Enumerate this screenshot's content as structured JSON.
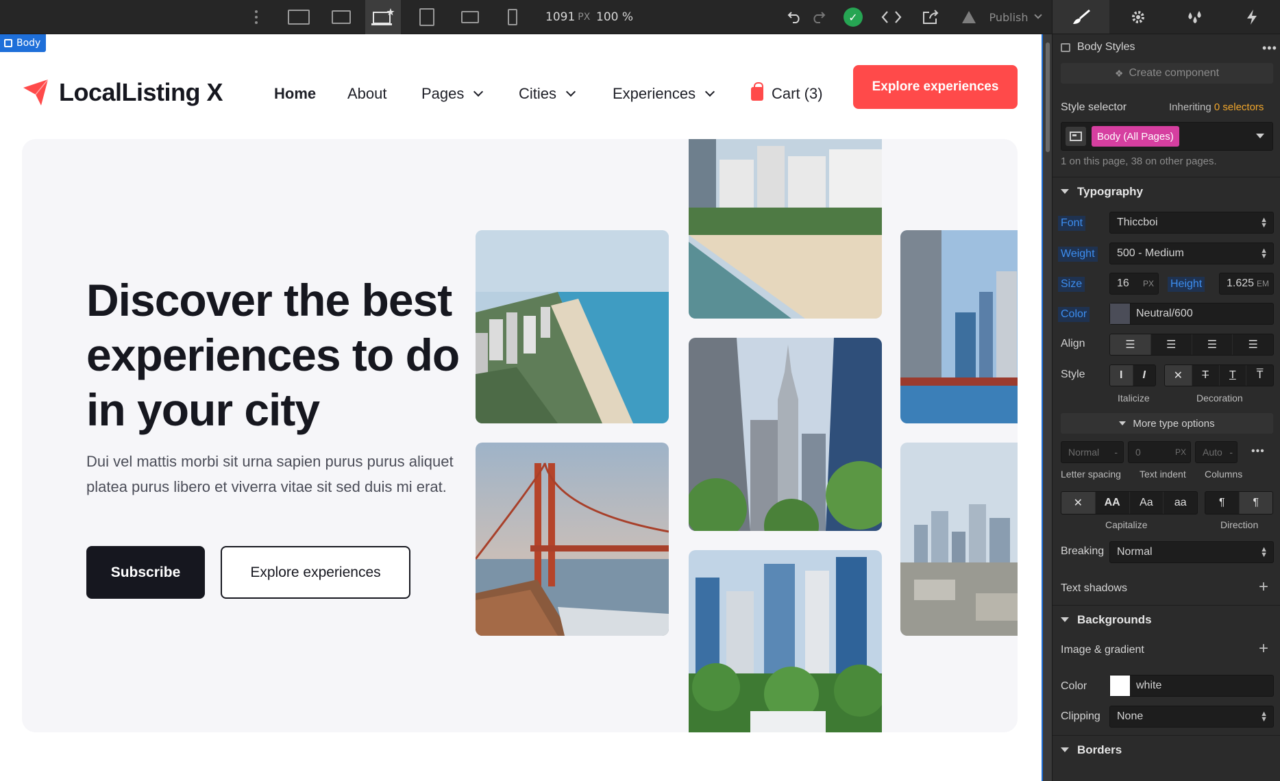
{
  "toolbar": {
    "width_value": "1091",
    "width_unit": "PX",
    "zoom_value": "100",
    "zoom_unit": "%",
    "publish_label": "Publish"
  },
  "canvas": {
    "body_tag_label": "Body"
  },
  "site": {
    "brand": "LocalListing X",
    "brand_color": "#ff4a4a",
    "nav": {
      "home": "Home",
      "about": "About",
      "pages": "Pages",
      "cities": "Cities",
      "experiences": "Experiences",
      "cart": "Cart (3)"
    },
    "nav_cta": "Explore experiences",
    "hero": {
      "title": "Discover the best experiences to do in your city",
      "text": "Dui vel mattis morbi sit urna sapien purus purus aliquet platea purus libero et viverra vitae sit sed duis mi erat.",
      "subscribe": "Subscribe",
      "explore": "Explore experiences"
    }
  },
  "panel": {
    "header": "Body Styles",
    "create_component": "Create component",
    "style_selector_label": "Style selector",
    "inheriting_prefix": "Inheriting",
    "inheriting_count": "0 selectors",
    "selector_chip": "Body (All Pages)",
    "selector_chip_color": "#d63fa0",
    "selector_note": "1 on this page, 38 on other pages.",
    "typography": {
      "title": "Typography",
      "font_label": "Font",
      "font_value": "Thiccboi",
      "weight_label": "Weight",
      "weight_value": "500 - Medium",
      "size_label": "Size",
      "size_value": "16",
      "size_unit": "PX",
      "height_label": "Height",
      "height_value": "1.625",
      "height_unit": "EM",
      "color_label": "Color",
      "color_value": "Neutral/600",
      "align_label": "Align",
      "style_label": "Style",
      "italicize_label": "Italicize",
      "decoration_label": "Decoration",
      "more_options": "More type options",
      "letter_spacing_value": "Normal",
      "text_indent_value": "0",
      "text_indent_unit": "PX",
      "columns_value": "Auto",
      "letter_spacing_label": "Letter spacing",
      "text_indent_label": "Text indent",
      "columns_label": "Columns",
      "capitalize_label": "Capitalize",
      "direction_label": "Direction",
      "breaking_label": "Breaking",
      "breaking_value": "Normal",
      "text_shadows_label": "Text shadows"
    },
    "backgrounds": {
      "title": "Backgrounds",
      "image_gradient_label": "Image & gradient",
      "color_label": "Color",
      "color_value": "white",
      "clipping_label": "Clipping",
      "clipping_value": "None"
    },
    "borders": {
      "title": "Borders"
    }
  }
}
